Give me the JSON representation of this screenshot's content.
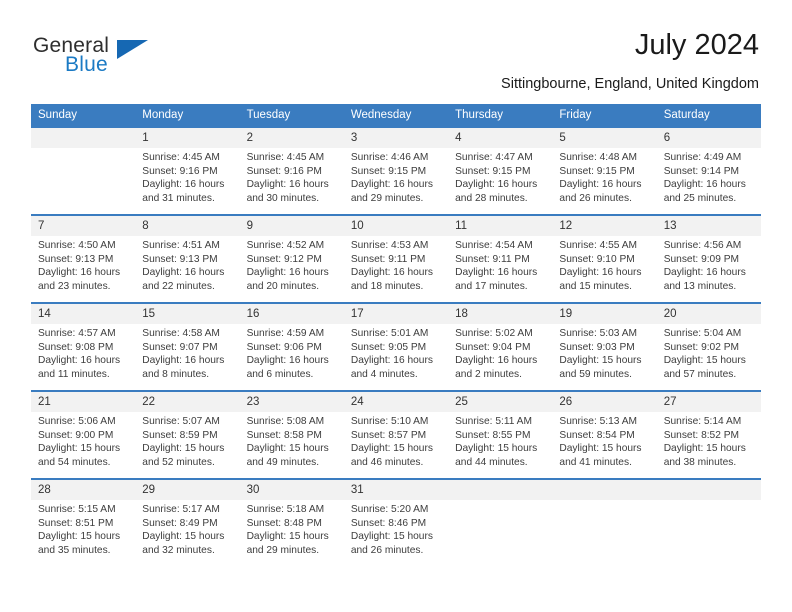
{
  "brand": {
    "name_part1": "General",
    "name_part2": "Blue",
    "accent_color": "#1668b3"
  },
  "header": {
    "title": "July 2024",
    "location": "Sittingbourne, England, United Kingdom"
  },
  "theme": {
    "header_row_color": "#3a7cc0",
    "daynum_band_color": "#f2f2f2"
  },
  "weekdays": [
    "Sunday",
    "Monday",
    "Tuesday",
    "Wednesday",
    "Thursday",
    "Friday",
    "Saturday"
  ],
  "weeks": [
    {
      "days": [
        {
          "num": "",
          "sunrise": "",
          "sunset": "",
          "daylight_line1": "",
          "daylight_line2": ""
        },
        {
          "num": "1",
          "sunrise": "Sunrise: 4:45 AM",
          "sunset": "Sunset: 9:16 PM",
          "daylight_line1": "Daylight: 16 hours",
          "daylight_line2": "and 31 minutes."
        },
        {
          "num": "2",
          "sunrise": "Sunrise: 4:45 AM",
          "sunset": "Sunset: 9:16 PM",
          "daylight_line1": "Daylight: 16 hours",
          "daylight_line2": "and 30 minutes."
        },
        {
          "num": "3",
          "sunrise": "Sunrise: 4:46 AM",
          "sunset": "Sunset: 9:15 PM",
          "daylight_line1": "Daylight: 16 hours",
          "daylight_line2": "and 29 minutes."
        },
        {
          "num": "4",
          "sunrise": "Sunrise: 4:47 AM",
          "sunset": "Sunset: 9:15 PM",
          "daylight_line1": "Daylight: 16 hours",
          "daylight_line2": "and 28 minutes."
        },
        {
          "num": "5",
          "sunrise": "Sunrise: 4:48 AM",
          "sunset": "Sunset: 9:15 PM",
          "daylight_line1": "Daylight: 16 hours",
          "daylight_line2": "and 26 minutes."
        },
        {
          "num": "6",
          "sunrise": "Sunrise: 4:49 AM",
          "sunset": "Sunset: 9:14 PM",
          "daylight_line1": "Daylight: 16 hours",
          "daylight_line2": "and 25 minutes."
        }
      ]
    },
    {
      "days": [
        {
          "num": "7",
          "sunrise": "Sunrise: 4:50 AM",
          "sunset": "Sunset: 9:13 PM",
          "daylight_line1": "Daylight: 16 hours",
          "daylight_line2": "and 23 minutes."
        },
        {
          "num": "8",
          "sunrise": "Sunrise: 4:51 AM",
          "sunset": "Sunset: 9:13 PM",
          "daylight_line1": "Daylight: 16 hours",
          "daylight_line2": "and 22 minutes."
        },
        {
          "num": "9",
          "sunrise": "Sunrise: 4:52 AM",
          "sunset": "Sunset: 9:12 PM",
          "daylight_line1": "Daylight: 16 hours",
          "daylight_line2": "and 20 minutes."
        },
        {
          "num": "10",
          "sunrise": "Sunrise: 4:53 AM",
          "sunset": "Sunset: 9:11 PM",
          "daylight_line1": "Daylight: 16 hours",
          "daylight_line2": "and 18 minutes."
        },
        {
          "num": "11",
          "sunrise": "Sunrise: 4:54 AM",
          "sunset": "Sunset: 9:11 PM",
          "daylight_line1": "Daylight: 16 hours",
          "daylight_line2": "and 17 minutes."
        },
        {
          "num": "12",
          "sunrise": "Sunrise: 4:55 AM",
          "sunset": "Sunset: 9:10 PM",
          "daylight_line1": "Daylight: 16 hours",
          "daylight_line2": "and 15 minutes."
        },
        {
          "num": "13",
          "sunrise": "Sunrise: 4:56 AM",
          "sunset": "Sunset: 9:09 PM",
          "daylight_line1": "Daylight: 16 hours",
          "daylight_line2": "and 13 minutes."
        }
      ]
    },
    {
      "days": [
        {
          "num": "14",
          "sunrise": "Sunrise: 4:57 AM",
          "sunset": "Sunset: 9:08 PM",
          "daylight_line1": "Daylight: 16 hours",
          "daylight_line2": "and 11 minutes."
        },
        {
          "num": "15",
          "sunrise": "Sunrise: 4:58 AM",
          "sunset": "Sunset: 9:07 PM",
          "daylight_line1": "Daylight: 16 hours",
          "daylight_line2": "and 8 minutes."
        },
        {
          "num": "16",
          "sunrise": "Sunrise: 4:59 AM",
          "sunset": "Sunset: 9:06 PM",
          "daylight_line1": "Daylight: 16 hours",
          "daylight_line2": "and 6 minutes."
        },
        {
          "num": "17",
          "sunrise": "Sunrise: 5:01 AM",
          "sunset": "Sunset: 9:05 PM",
          "daylight_line1": "Daylight: 16 hours",
          "daylight_line2": "and 4 minutes."
        },
        {
          "num": "18",
          "sunrise": "Sunrise: 5:02 AM",
          "sunset": "Sunset: 9:04 PM",
          "daylight_line1": "Daylight: 16 hours",
          "daylight_line2": "and 2 minutes."
        },
        {
          "num": "19",
          "sunrise": "Sunrise: 5:03 AM",
          "sunset": "Sunset: 9:03 PM",
          "daylight_line1": "Daylight: 15 hours",
          "daylight_line2": "and 59 minutes."
        },
        {
          "num": "20",
          "sunrise": "Sunrise: 5:04 AM",
          "sunset": "Sunset: 9:02 PM",
          "daylight_line1": "Daylight: 15 hours",
          "daylight_line2": "and 57 minutes."
        }
      ]
    },
    {
      "days": [
        {
          "num": "21",
          "sunrise": "Sunrise: 5:06 AM",
          "sunset": "Sunset: 9:00 PM",
          "daylight_line1": "Daylight: 15 hours",
          "daylight_line2": "and 54 minutes."
        },
        {
          "num": "22",
          "sunrise": "Sunrise: 5:07 AM",
          "sunset": "Sunset: 8:59 PM",
          "daylight_line1": "Daylight: 15 hours",
          "daylight_line2": "and 52 minutes."
        },
        {
          "num": "23",
          "sunrise": "Sunrise: 5:08 AM",
          "sunset": "Sunset: 8:58 PM",
          "daylight_line1": "Daylight: 15 hours",
          "daylight_line2": "and 49 minutes."
        },
        {
          "num": "24",
          "sunrise": "Sunrise: 5:10 AM",
          "sunset": "Sunset: 8:57 PM",
          "daylight_line1": "Daylight: 15 hours",
          "daylight_line2": "and 46 minutes."
        },
        {
          "num": "25",
          "sunrise": "Sunrise: 5:11 AM",
          "sunset": "Sunset: 8:55 PM",
          "daylight_line1": "Daylight: 15 hours",
          "daylight_line2": "and 44 minutes."
        },
        {
          "num": "26",
          "sunrise": "Sunrise: 5:13 AM",
          "sunset": "Sunset: 8:54 PM",
          "daylight_line1": "Daylight: 15 hours",
          "daylight_line2": "and 41 minutes."
        },
        {
          "num": "27",
          "sunrise": "Sunrise: 5:14 AM",
          "sunset": "Sunset: 8:52 PM",
          "daylight_line1": "Daylight: 15 hours",
          "daylight_line2": "and 38 minutes."
        }
      ]
    },
    {
      "days": [
        {
          "num": "28",
          "sunrise": "Sunrise: 5:15 AM",
          "sunset": "Sunset: 8:51 PM",
          "daylight_line1": "Daylight: 15 hours",
          "daylight_line2": "and 35 minutes."
        },
        {
          "num": "29",
          "sunrise": "Sunrise: 5:17 AM",
          "sunset": "Sunset: 8:49 PM",
          "daylight_line1": "Daylight: 15 hours",
          "daylight_line2": "and 32 minutes."
        },
        {
          "num": "30",
          "sunrise": "Sunrise: 5:18 AM",
          "sunset": "Sunset: 8:48 PM",
          "daylight_line1": "Daylight: 15 hours",
          "daylight_line2": "and 29 minutes."
        },
        {
          "num": "31",
          "sunrise": "Sunrise: 5:20 AM",
          "sunset": "Sunset: 8:46 PM",
          "daylight_line1": "Daylight: 15 hours",
          "daylight_line2": "and 26 minutes."
        },
        {
          "num": "",
          "sunrise": "",
          "sunset": "",
          "daylight_line1": "",
          "daylight_line2": ""
        },
        {
          "num": "",
          "sunrise": "",
          "sunset": "",
          "daylight_line1": "",
          "daylight_line2": ""
        },
        {
          "num": "",
          "sunrise": "",
          "sunset": "",
          "daylight_line1": "",
          "daylight_line2": ""
        }
      ]
    }
  ]
}
